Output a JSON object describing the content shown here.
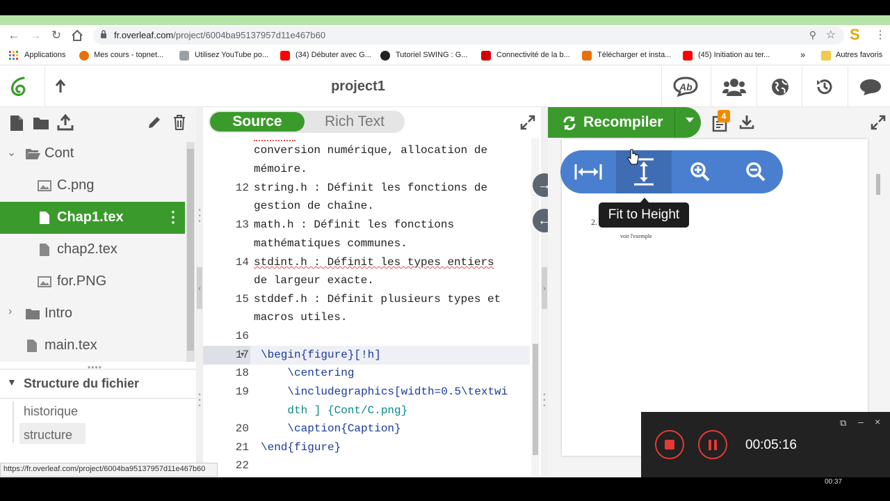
{
  "browser": {
    "url_host": "fr.overleaf.com",
    "url_path": "/project/6004ba95137957d11e467b60",
    "profile_initial": "S",
    "bookmarks": [
      {
        "label": "Applications",
        "color": "#4285f4"
      },
      {
        "label": "Mes cours - topnet...",
        "color": "#e8710a"
      },
      {
        "label": "Utilisez YouTube po...",
        "color": "#9aa0a6"
      },
      {
        "label": "(34) Débuter avec G...",
        "color": "#ff0000"
      },
      {
        "label": "Tutoriel SWING : G...",
        "color": "#202124"
      },
      {
        "label": "Connectivité de la b...",
        "color": "#d50000"
      },
      {
        "label": "Télécharger et insta...",
        "color": "#e8710a"
      },
      {
        "label": "(45) Initiation au ter...",
        "color": "#ff0000"
      }
    ],
    "more_bookmarks": "»",
    "other_favorites": "Autres favoris"
  },
  "header": {
    "project_title": "project1",
    "badge_count": "4"
  },
  "file_tree": {
    "items": [
      {
        "label": "Cont",
        "type": "folder-open"
      },
      {
        "label": "C.png",
        "type": "image"
      },
      {
        "label": "Chap1.tex",
        "type": "file",
        "selected": true
      },
      {
        "label": "chap2.tex",
        "type": "file"
      },
      {
        "label": "for.PNG",
        "type": "image"
      },
      {
        "label": "Intro",
        "type": "folder"
      },
      {
        "label": "main.tex",
        "type": "file"
      }
    ]
  },
  "outline": {
    "title": "Structure du fichier",
    "items": [
      "historique",
      "structure"
    ]
  },
  "editor": {
    "source_label": "Source",
    "rich_text_label": "Rich Text",
    "lines": [
      {
        "num": "",
        "text": "conversion numérique, allocation de"
      },
      {
        "num": "",
        "text": "mémoire."
      },
      {
        "num": "12",
        "text": "string.h : Définit les fonctions de"
      },
      {
        "num": "",
        "text": "gestion de chaîne."
      },
      {
        "num": "13",
        "text": "math.h : Définit les fonctions"
      },
      {
        "num": "",
        "text": "mathématiques communes."
      },
      {
        "num": "14",
        "text": "stdint.h : Définit les types entiers"
      },
      {
        "num": "",
        "text": "de largeur exacte."
      },
      {
        "num": "15",
        "text": "stddef.h : Définit plusieurs types et"
      },
      {
        "num": "",
        "text": "macros utiles."
      },
      {
        "num": "16",
        "text": ""
      },
      {
        "num": "17",
        "text": "\\begin{figure}[!h]"
      },
      {
        "num": "18",
        "text": "    \\centering"
      },
      {
        "num": "19",
        "text": "    \\includegraphics[width=0.5\\textwi"
      },
      {
        "num": "",
        "text": "    dth ] {Cont/C.png}"
      },
      {
        "num": "20",
        "text": "    \\caption{Caption}"
      },
      {
        "num": "21",
        "text": "\\end{figure}"
      },
      {
        "num": "22",
        "text": ""
      }
    ]
  },
  "pdf": {
    "recompile_label": "Recompiler",
    "tooltip": "Fit to Height",
    "page_heading_fragment": "2.",
    "page_caption_fragment": "voir l'exemple"
  },
  "recorder": {
    "elapsed": "00:05:16"
  },
  "status_url": "https://fr.overleaf.com/project/6004ba95137957d11e467b60",
  "taskbar_clock": "00:37"
}
